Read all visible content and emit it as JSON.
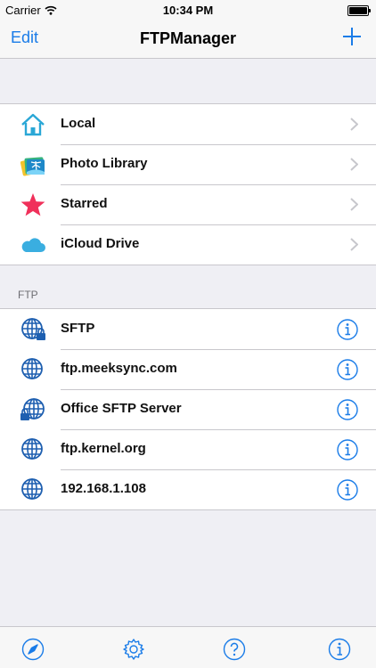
{
  "status": {
    "carrier": "Carrier",
    "time": "10:34 PM"
  },
  "nav": {
    "edit_label": "Edit",
    "title": "FTPManager"
  },
  "locations": [
    {
      "label": "Local",
      "icon": "house-icon"
    },
    {
      "label": "Photo Library",
      "icon": "photo-library-icon"
    },
    {
      "label": "Starred",
      "icon": "star-icon"
    },
    {
      "label": "iCloud Drive",
      "icon": "cloud-icon"
    }
  ],
  "ftp": {
    "header": "FTP",
    "servers": [
      {
        "label": "SFTP",
        "icon": "globe-lock-icon"
      },
      {
        "label": "ftp.meeksync.com",
        "icon": "globe-icon"
      },
      {
        "label": "Office SFTP Server",
        "icon": "globe-lock-icon"
      },
      {
        "label": "ftp.kernel.org",
        "icon": "globe-icon"
      },
      {
        "label": "192.168.1.108",
        "icon": "globe-icon"
      }
    ]
  },
  "colors": {
    "accent": "#1a7ce8",
    "star": "#f0305a",
    "house": "#2aa7d6",
    "cloud": "#3aaee0"
  }
}
